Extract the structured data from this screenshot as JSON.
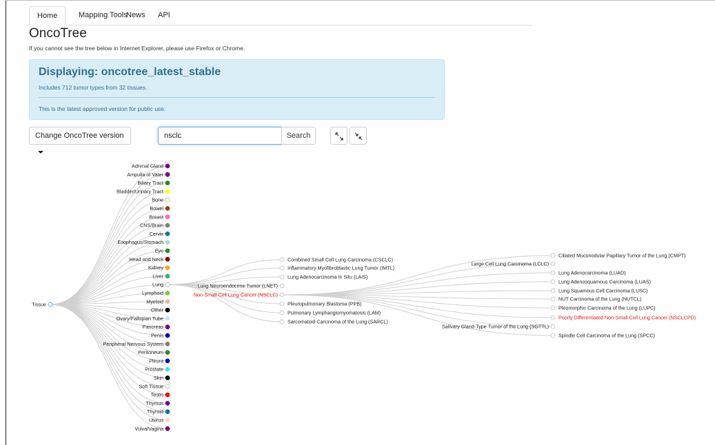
{
  "nav": {
    "tabs": [
      {
        "label": "Home",
        "active": true
      },
      {
        "label": "Mapping Tools",
        "active": false
      },
      {
        "label": "News",
        "active": false
      },
      {
        "label": "API",
        "active": false
      }
    ]
  },
  "page": {
    "title": "OncoTree",
    "ie_note": "If you cannot see the tree below in Internet Explorer, please use Firefox or Chrome."
  },
  "info": {
    "title": "Displaying: oncotree_latest_stable",
    "subtitle": "Includes 712 tumor types from 32 tissues.",
    "footer": "This is the latest approved version for public use."
  },
  "controls": {
    "version_button": "Change OncoTree version",
    "search_value": "nsclc",
    "search_button": "Search",
    "expand_icon": "expand-arrows-icon",
    "collapse_icon": "collapse-arrows-icon"
  },
  "colors": {
    "info_bg": "#d9edf7",
    "info_text": "#31708f",
    "highlight": "#e8140c",
    "link": "#d0d0d0"
  },
  "tree": {
    "root": "Tissue",
    "tissues": [
      {
        "label": "Adrenal Gland",
        "color": "#800080"
      },
      {
        "label": "Ampulla of Vater",
        "color": "#800080"
      },
      {
        "label": "Biliary Tract",
        "color": "#228b22"
      },
      {
        "label": "Bladder/Urinary Tract",
        "color": "#ffff00"
      },
      {
        "label": "Bone",
        "color": "#ffffff"
      },
      {
        "label": "Bowel",
        "color": "#8b4513"
      },
      {
        "label": "Breast",
        "color": "#ff69b4"
      },
      {
        "label": "CNS/Brain",
        "color": "#808080"
      },
      {
        "label": "Cervix",
        "color": "#008080"
      },
      {
        "label": "Esophagus/Stomach",
        "color": "#add8e6"
      },
      {
        "label": "Eye",
        "color": "#228b22"
      },
      {
        "label": "Head and Neck",
        "color": "#8b0000"
      },
      {
        "label": "Kidney",
        "color": "#f5a623"
      },
      {
        "label": "Liver",
        "color": "#3cb371"
      },
      {
        "label": "Lung",
        "color": "#ffffff"
      },
      {
        "label": "Lymphoid",
        "color": "#7ccd32"
      },
      {
        "label": "Myeloid",
        "color": "#e9b89d"
      },
      {
        "label": "Other",
        "color": "#000000"
      },
      {
        "label": "Ovary/Fallopian Tube",
        "color": "#c8e6f7"
      },
      {
        "label": "Pancreas",
        "color": "#800080"
      },
      {
        "label": "Penis",
        "color": "#0000cd"
      },
      {
        "label": "Peripheral Nervous System",
        "color": "#808080"
      },
      {
        "label": "Peritoneum",
        "color": "#228b22"
      },
      {
        "label": "Pleura",
        "color": "#0000cd"
      },
      {
        "label": "Prostate",
        "color": "#40e0ff"
      },
      {
        "label": "Skin",
        "color": "#000000"
      },
      {
        "label": "Soft Tissue",
        "color": "#ffffff"
      },
      {
        "label": "Testis",
        "color": "#ff0000"
      },
      {
        "label": "Thymus",
        "color": "#800080"
      },
      {
        "label": "Thyroid",
        "color": "#008080"
      },
      {
        "label": "Uterus",
        "color": "#f8d9cc"
      },
      {
        "label": "Vulva/Vagina",
        "color": "#800080"
      }
    ],
    "lung_children": [
      {
        "label": "Combined Small Cell Lung Carcinoma (CSCLC)",
        "highlight": false
      },
      {
        "label": "Inflammatory Myofibroblastic Lung Tumor (IMTL)",
        "highlight": false
      },
      {
        "label": "Lung Adenocarcinoma In Situ (LAIS)",
        "highlight": false
      },
      {
        "label": "Lung Neuroendocrine Tumor (LNET)",
        "highlight": false
      },
      {
        "label": "Non-Small Cell Lung Cancer (NSCLC)",
        "highlight": true
      },
      {
        "label": "Pleuropulmonary Blastoma (PPB)",
        "highlight": false
      },
      {
        "label": "Pulmonary Lymphangiomyomatosis (LAM)",
        "highlight": false
      },
      {
        "label": "Sarcomatoid Carcinoma of the Lung (SARCL)",
        "highlight": false
      }
    ],
    "nsclc_children": [
      {
        "label": "Large Cell Lung Carcinoma (LCLC)",
        "highlight": false
      },
      {
        "label": "Salivary Gland-Type Tumor of the Lung (SGTTL)",
        "highlight": false
      }
    ],
    "leaf_nodes": [
      {
        "label": "Ciliated Muconodular Papillary Tumor of the Lung (CMPT)",
        "highlight": false
      },
      {
        "label": "Lung Adenocarcinoma (LUAD)",
        "highlight": false
      },
      {
        "label": "Lung Adenosquamous Carcinoma (LUAS)",
        "highlight": false
      },
      {
        "label": "Lung Squamous Cell Carcinoma (LUSC)",
        "highlight": false
      },
      {
        "label": "NUT Carcinoma of the Lung (NUTCL)",
        "highlight": false
      },
      {
        "label": "Pleomorphic Carcinoma of the Lung (LUPC)",
        "highlight": false
      },
      {
        "label": "Poorly Differentiated Non-Small Cell Lung Cancer (NSCLCPD)",
        "highlight": true
      },
      {
        "label": "Spindle Cell Carcinoma of the Lung (SPCC)",
        "highlight": false
      }
    ]
  }
}
